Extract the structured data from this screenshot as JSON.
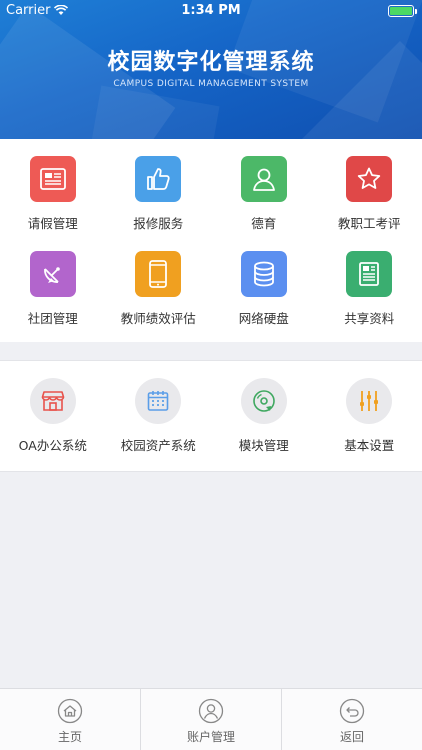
{
  "status_bar": {
    "carrier": "Carrier",
    "time": "1:34 PM"
  },
  "header": {
    "title": "校园数字化管理系统",
    "subtitle": "CAMPUS DIGITAL MANAGEMENT SYSTEM"
  },
  "main_grid": [
    {
      "label": "请假管理",
      "icon": "leave-form-icon",
      "color": "#ee5a55"
    },
    {
      "label": "报修服务",
      "icon": "thumbs-up-icon",
      "color": "#4aa0e8"
    },
    {
      "label": "德育",
      "icon": "person-icon",
      "color": "#4cb868"
    },
    {
      "label": "教职工考评",
      "icon": "star-icon",
      "color": "#e04848"
    },
    {
      "label": "社团管理",
      "icon": "satellite-dish-icon",
      "color": "#b265cc"
    },
    {
      "label": "教师绩效评估",
      "icon": "phone-icon",
      "color": "#f0a020"
    },
    {
      "label": "网络硬盘",
      "icon": "database-icon",
      "color": "#5b8ff0"
    },
    {
      "label": "共享资料",
      "icon": "newspaper-icon",
      "color": "#3aae70"
    }
  ],
  "system_grid": [
    {
      "label": "OA办公系统",
      "icon": "store-icon",
      "color": "#e8534c"
    },
    {
      "label": "校园资产系统",
      "icon": "calendar-icon",
      "color": "#5b9ee8"
    },
    {
      "label": "模块管理",
      "icon": "disc-icon",
      "color": "#3fa860"
    },
    {
      "label": "基本设置",
      "icon": "sliders-icon",
      "color": "#f0a020"
    }
  ],
  "tabbar": [
    {
      "label": "主页",
      "icon": "home-icon"
    },
    {
      "label": "账户管理",
      "icon": "user-icon"
    },
    {
      "label": "返回",
      "icon": "return-icon"
    }
  ]
}
